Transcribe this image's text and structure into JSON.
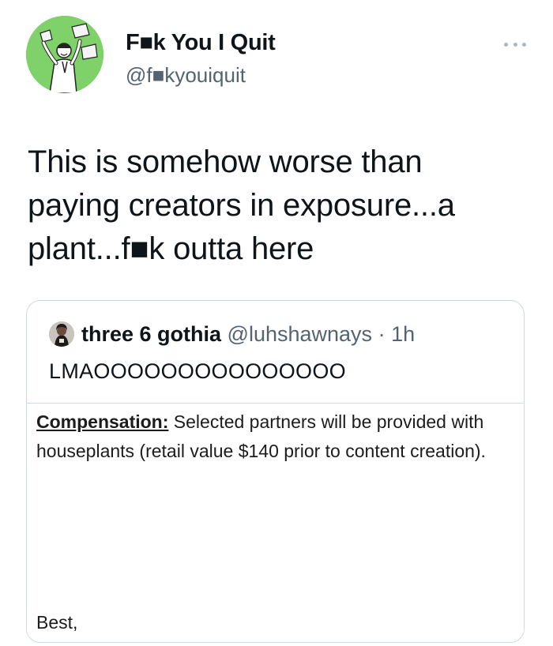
{
  "author": {
    "display_name": "F■k You I Quit",
    "handle": "@f■kyouiquit"
  },
  "tweet": {
    "text": "This is somehow worse than paying creators in exposure...a plant...f■k outta here"
  },
  "quoted_tweet": {
    "display_name": "three 6 gothia",
    "handle": "@luhshawnays",
    "separator": "·",
    "time": "1h",
    "text": "LMAOOOOOOOOOOOOOOO",
    "image": {
      "label": "Compensation:",
      "body": " Selected partners will be provided with houseplants (retail value $140 prior to content creation).",
      "closing": "Best,"
    }
  },
  "icons": {
    "more": "more-horizontal-icon"
  },
  "colors": {
    "avatar_bg": "#7fd16a",
    "secondary_text": "#536471",
    "border": "#cfd9de"
  }
}
